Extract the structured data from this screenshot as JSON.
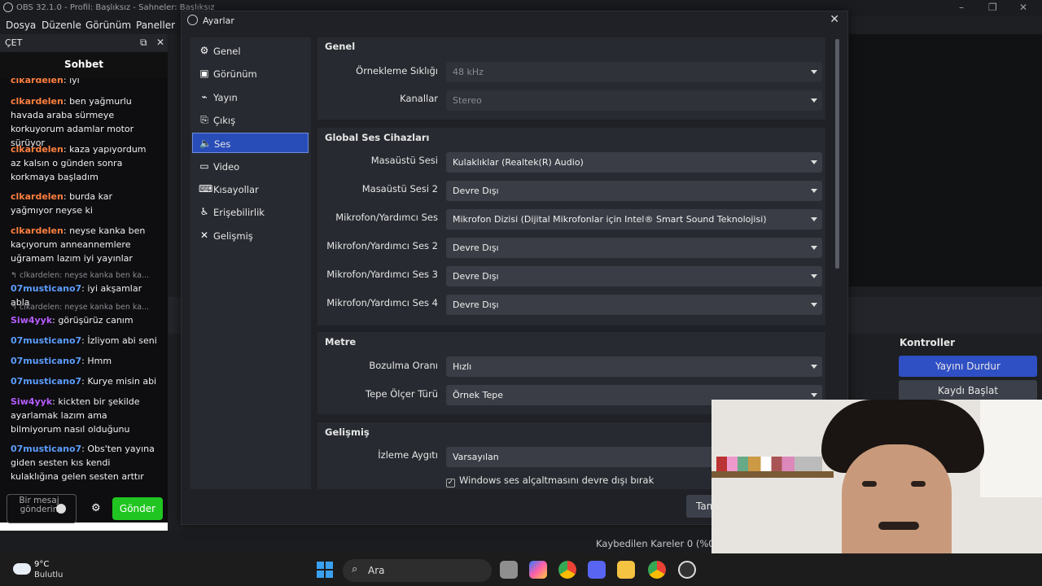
{
  "obs": {
    "title": "OBS 32.1.0 - Profil: Başlıksız - Sahneler: Başlıksız",
    "menu": [
      "Dosya",
      "Düzenle",
      "Görünüm",
      "Paneller"
    ],
    "window_controls": [
      "–",
      "❐",
      "✕"
    ]
  },
  "chat": {
    "dock_title": "ÇET",
    "header": "Sohbet",
    "messages": [
      {
        "user": "clkardelen",
        "color": "#ff7f3f",
        "text": "iyi"
      },
      {
        "user": "clkardelen",
        "color": "#ff7f3f",
        "text": "ben yağmurlu havada araba sürmeye korkuyorum adamlar motor sürüyor"
      },
      {
        "user": "clkardelen",
        "color": "#ff7f3f",
        "text": "kaza yapıyordum az kalsın o günden sonra korkmaya başladım"
      },
      {
        "user": "clkardelen",
        "color": "#ff7f3f",
        "text": "burda kar yağmıyor neyse ki"
      },
      {
        "user": "clkardelen",
        "color": "#ff7f3f",
        "text": "neyse kanka ben kaçıyorum anneannemlere uğramam lazım iyi yayınlar"
      },
      {
        "reply": "↰ clkardelen: neyse kanka ben ka..."
      },
      {
        "user": "07musticano7",
        "color": "#5c9dff",
        "text": "iyi akşamlar abla"
      },
      {
        "reply": "↰ clkardelen: neyse kanka ben ka..."
      },
      {
        "user": "Siw4yyk",
        "color": "#b65cff",
        "text": "görüşürüz canım"
      },
      {
        "user": "07musticano7",
        "color": "#5c9dff",
        "text": "İzliyom abi seni"
      },
      {
        "user": "07musticano7",
        "color": "#5c9dff",
        "text": "Hmm"
      },
      {
        "user": "07musticano7",
        "color": "#5c9dff",
        "text": "Kurye misin abi"
      },
      {
        "user": "Siw4yyk",
        "color": "#b65cff",
        "text": "kickten bir şekilde ayarlamak lazım ama bilmiyorum nasıl olduğunu"
      },
      {
        "user": "07musticano7",
        "color": "#5c9dff",
        "text": "Obs'ten yayına giden sesten kıs kendi kulaklığına gelen sesten arttır"
      }
    ],
    "input_placeholder": "Bir mesaj gönderin",
    "send_label": "Gönder"
  },
  "settings": {
    "title": "Ayarlar",
    "close": "✕",
    "nav": [
      {
        "label": "Genel",
        "icon": "⚙",
        "name": "gear-icon"
      },
      {
        "label": "Görünüm",
        "icon": "▣",
        "name": "appearance-icon"
      },
      {
        "label": "Yayın",
        "icon": "⌁",
        "name": "antenna-icon"
      },
      {
        "label": "Çıkış",
        "icon": "⎘",
        "name": "output-icon"
      },
      {
        "label": "Ses",
        "icon": "🔈",
        "name": "speaker-icon"
      },
      {
        "label": "Video",
        "icon": "▭",
        "name": "monitor-icon"
      },
      {
        "label": "Kısayollar",
        "icon": "⌨",
        "name": "keyboard-icon"
      },
      {
        "label": "Erişebilirlik",
        "icon": "♿",
        "name": "accessibility-icon"
      },
      {
        "label": "Gelişmiş",
        "icon": "✕",
        "name": "tools-icon"
      }
    ],
    "active_nav": "Ses",
    "genel": {
      "title": "Genel",
      "rows": [
        {
          "label": "Örnekleme Sıklığı",
          "value": "48 kHz"
        },
        {
          "label": "Kanallar",
          "value": "Stereo"
        }
      ]
    },
    "global": {
      "title": "Global Ses Cihazları",
      "rows": [
        {
          "label": "Masaüstü Sesi",
          "value": "Kulaklıklar (Realtek(R) Audio)"
        },
        {
          "label": "Masaüstü Sesi 2",
          "value": "Devre Dışı"
        },
        {
          "label": "Mikrofon/Yardımcı Ses",
          "value": "Mikrofon Dizisi (Dijital Mikrofonlar için Intel® Smart Sound Teknolojisi)"
        },
        {
          "label": "Mikrofon/Yardımcı Ses 2",
          "value": "Devre Dışı"
        },
        {
          "label": "Mikrofon/Yardımcı Ses 3",
          "value": "Devre Dışı"
        },
        {
          "label": "Mikrofon/Yardımcı Ses 4",
          "value": "Devre Dışı"
        }
      ]
    },
    "metre": {
      "title": "Metre",
      "rows": [
        {
          "label": "Bozulma Oranı",
          "value": "Hızlı"
        },
        {
          "label": "Tepe Ölçer Türü",
          "value": "Örnek Tepe"
        }
      ]
    },
    "gelismis": {
      "title": "Gelişmiş",
      "rows": [
        {
          "label": "İzleme Aygıtı",
          "value": "Varsayılan"
        }
      ],
      "checkbox": "Windows ses alçaltmasını devre dışı bırak",
      "checkbox_checked": true
    },
    "partial_button": "Tam"
  },
  "controls": {
    "title": "Kontroller",
    "stop_stream": "Yayını Durdur",
    "start_record": "Kaydı Başlat",
    "accent": "#2f4fc4"
  },
  "status": {
    "dropped_frames": "Kaybedilen Kareler 0 (%0.0)"
  },
  "taskbar": {
    "temp": "9°C",
    "weather": "Bulutlu",
    "search": "Ara"
  }
}
